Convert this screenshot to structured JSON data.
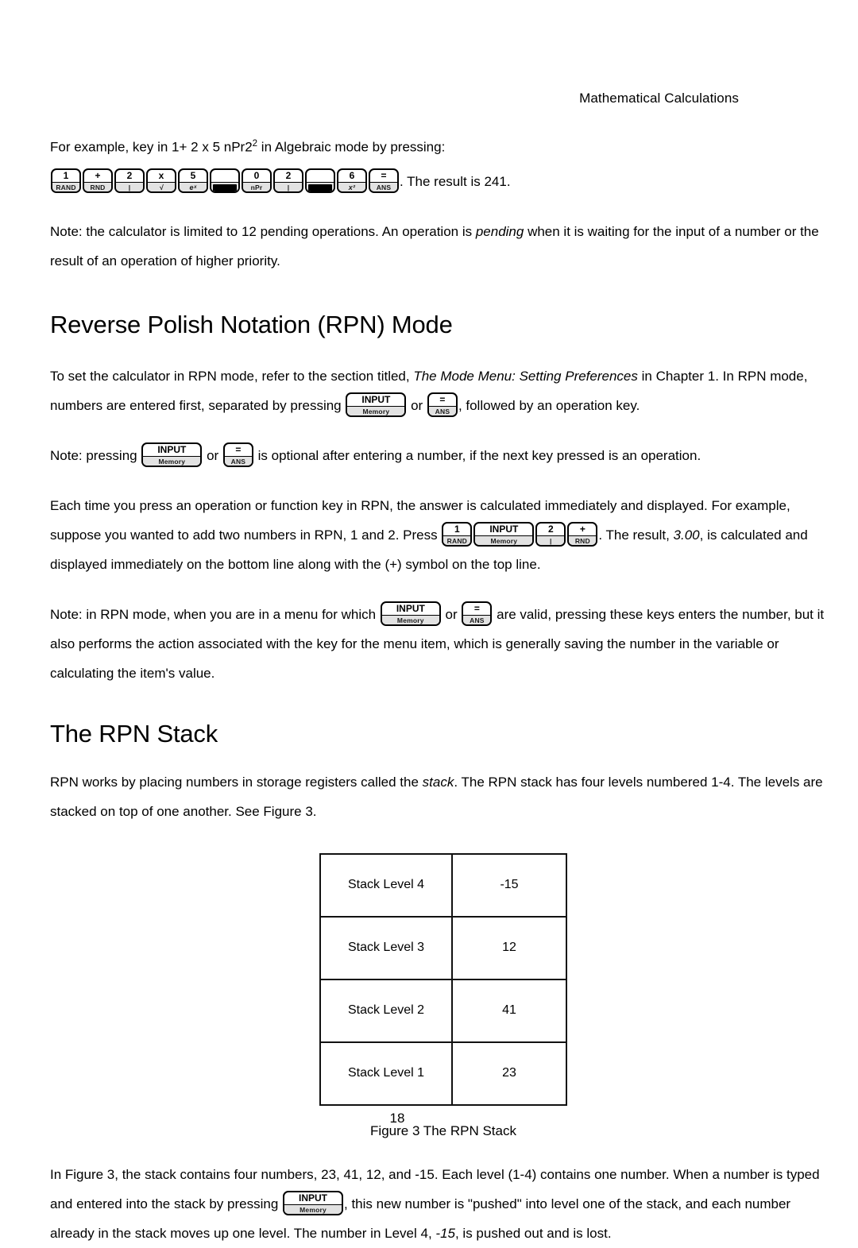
{
  "page": {
    "running_head": "Mathematical Calculations",
    "page_number": "18"
  },
  "intro": {
    "line1_a": "For example, key in 1+ 2 x 5 nPr2",
    "line1_sup": "2",
    "line1_b": " in Algebraic mode by pressing:",
    "result_text": ". The result is 241.",
    "note_pending": "Note: the calculator is limited to 12 pending operations. An operation is ",
    "note_pending_em": "pending",
    "note_pending_tail": " when it is waiting for the input of a number or the result of an operation of higher priority."
  },
  "keys": {
    "one": {
      "top": "1",
      "bottom": "RAND"
    },
    "plus": {
      "top": "+",
      "bottom": "RND"
    },
    "two": {
      "top": "2",
      "bottom": "|"
    },
    "times": {
      "top": "x",
      "bottom": "√"
    },
    "five": {
      "top": "5",
      "bottom": "eˣ"
    },
    "blank_bar": {
      "top": "",
      "bottom": ""
    },
    "zero": {
      "top": "0",
      "bottom": "nPr"
    },
    "six": {
      "top": "6",
      "bottom": "x²"
    },
    "equals": {
      "top": "=",
      "bottom": "ANS"
    },
    "input": {
      "top": "INPUT",
      "bottom": "Memory"
    }
  },
  "rpn_mode": {
    "heading": "Reverse Polish Notation (RPN) Mode",
    "p1_a": "To set the calculator in RPN mode, refer to the section titled, ",
    "p1_em": "The Mode Menu: Setting Preferences",
    "p1_b": " in Chapter 1. In RPN mode, numbers are entered first, separated by pressing ",
    "p1_or": " or ",
    "p1_c": ", followed by an operation key.",
    "p2_a": "Note: pressing ",
    "p2_or": " or ",
    "p2_b": " is optional after entering a number, if the next key pressed is an operation.",
    "p3_a": "Each time you press an operation or function key in RPN, the answer is calculated immediately and displayed. For example, suppose you wanted to add two numbers in RPN, 1 and 2. Press ",
    "p3_b": ". The result, ",
    "p3_em": "3.00",
    "p3_c": ", is calculated and displayed immediately on the bottom line along with the (+) symbol on the top line.",
    "p4_a": "Note: in RPN mode, when you are in a menu for which ",
    "p4_or": " or ",
    "p4_b": " are valid, pressing these keys enters the number, but it also performs the action associated with the key for the menu item, which is generally saving the number in the variable or calculating the item's value."
  },
  "rpn_stack": {
    "heading": "The RPN Stack",
    "p1_a": "RPN works by placing numbers in storage registers called the ",
    "p1_em": "stack",
    "p1_b": ". The RPN stack has four levels numbered 1-4. The levels are stacked on top of one another. See Figure 3.",
    "caption": "Figure 3 The RPN Stack",
    "rows": [
      {
        "label": "Stack Level 4",
        "value": "-15"
      },
      {
        "label": "Stack Level 3",
        "value": "12"
      },
      {
        "label": "Stack Level 2",
        "value": "41"
      },
      {
        "label": "Stack Level 1",
        "value": "23"
      }
    ],
    "p2_a": "In Figure 3, the stack contains four numbers, 23, 41, 12, and -15. Each level (1-4) contains one number. When a number is typed and entered into the stack by pressing ",
    "p2_b": ", this new number is \"pushed\" into level one of the stack, and each number already in the stack moves up one level. The number in Level 4, ",
    "p2_em": "-15",
    "p2_c": ", is pushed out and is lost."
  }
}
